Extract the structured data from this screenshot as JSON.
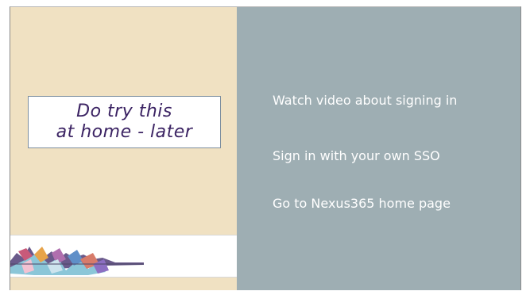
{
  "slide": {
    "callout": {
      "line1": "Do try this",
      "line2": "at home - later"
    },
    "links": [
      {
        "label": "Watch video about signing in"
      },
      {
        "label": "Sign in with your own SSO"
      },
      {
        "label": "Go to Nexus365 home page"
      }
    ]
  },
  "colors": {
    "left_panel": "#f0e1c2",
    "right_panel": "#9eaeb3",
    "callout_text": "#3b2363",
    "link_text": "#ffffff"
  }
}
